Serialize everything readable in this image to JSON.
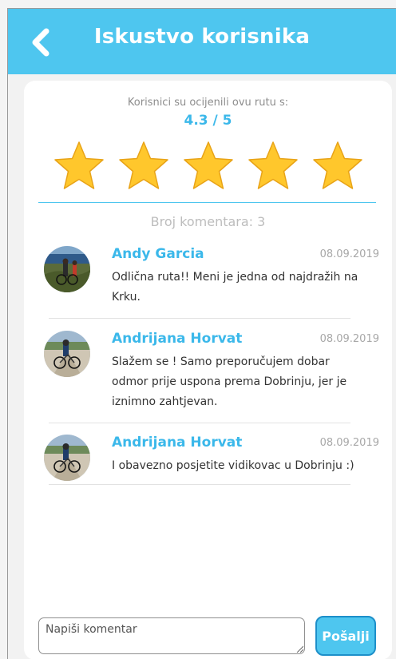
{
  "header": {
    "title": "Iskustvo korisnika",
    "back_icon": "chevron-left-icon",
    "background_color": "#4ec6ef"
  },
  "rating": {
    "caption": "Korisnici su ocijenili ovu rutu s:",
    "value_text": "4.3 / 5",
    "stars_total": 5,
    "stars_filled": 5,
    "star_color": "#ffc72c"
  },
  "comments_count_label": "Broj komentara: 3",
  "comments": [
    {
      "author": "Andy Garcia",
      "date": "08.09.2019",
      "text": "Odlična ruta!! Meni je jedna od najdražih na Krku."
    },
    {
      "author": "Andrijana Horvat",
      "date": "08.09.2019",
      "text": "Slažem se ! Samo preporučujem dobar odmor prije uspona prema Dobrinju, jer je iznimno zahtjevan."
    },
    {
      "author": "Andrijana Horvat",
      "date": "08.09.2019",
      "text": "I obavezno posjetite vidikovac u Dobrinju :)"
    }
  ],
  "composer": {
    "placeholder": "Napiši komentar",
    "send_label": "Pošalji"
  },
  "accent_color": "#3bb8ea"
}
